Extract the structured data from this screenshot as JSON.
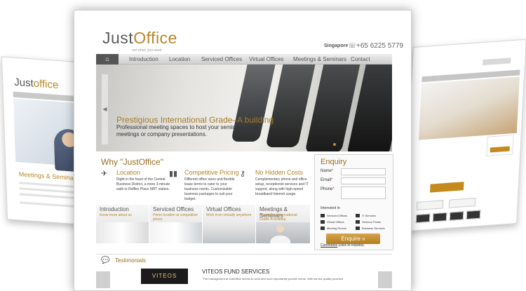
{
  "brand": {
    "logo_just": "Just",
    "logo_office": "Office",
    "tagline": "not when you need",
    "accent": "#b9862b",
    "button_color": "#c58a1d"
  },
  "header": {
    "region": "Singapore",
    "phone_icon": "phone-icon",
    "phone": "+65 6225 5779"
  },
  "nav": {
    "home_icon": "home-icon",
    "items": [
      "Introduction",
      "Location",
      "Serviced Offices",
      "Virtual Offices",
      "Meetings & Seminars",
      "Contact"
    ]
  },
  "hero": {
    "prev_arrow": "◀",
    "title": "Prestigious International Grade–A building",
    "description": "Professional meeting spaces to host your seminars, client meetings or company presentations."
  },
  "why": {
    "title": "Why \"JustOffice\"",
    "features": [
      {
        "icon": "location-icon",
        "title": "Location",
        "desc": "Right in the heart of the Central Business District, a mere 3-minute walk to Raffles Place MRT station."
      },
      {
        "icon": "bar-chart-icon",
        "title": "Competitive Pricing",
        "desc": "Different office sizes and flexible lease terms to cater to your business needs. Customizable business packages to suit your budget."
      },
      {
        "icon": "key-icon",
        "title": "No Hidden Costs",
        "desc": "Complementary phone and office setup, receptionist services and IT support, along with high-speed broadband Internet usage."
      }
    ]
  },
  "tiles": [
    {
      "title": "Introduction",
      "desc": "Know more about us"
    },
    {
      "title": "Serviced Offices",
      "desc": "Prime location at competitive prices"
    },
    {
      "title": "Virtual Offices",
      "desc": "Work from virtually anywhere"
    },
    {
      "title": "Meetings & Seminars",
      "desc": "Prestigious International Grade-A building"
    }
  ],
  "enquiry": {
    "title": "Enquiry",
    "fields": [
      {
        "label": "Name",
        "required": "*",
        "value": ""
      },
      {
        "label": "Email",
        "required": "*",
        "value": ""
      },
      {
        "label": "Phone",
        "required": "*",
        "value": ""
      }
    ],
    "interested_label": "Interested In",
    "options": [
      "Serviced Offices",
      "IT Services",
      "Virtual Offices",
      "Seminar Points",
      "Meeting Rooms",
      "Business Services"
    ],
    "comments_label": "Comments",
    "comments_link": "(click to expand)",
    "button": "Enquire »"
  },
  "testimonials": {
    "icon": "speech-bubble-icon",
    "title": "Testimonials",
    "logo_text": "VITEOS",
    "company": "VITEOS FUND SERVICES",
    "quote": "\"The management at JustOffice seems to work and more importantly provide needs. With service quality provided"
  },
  "left_preview": {
    "logo_just": "Just",
    "logo_office": "office",
    "heading": "Meetings & Seminars"
  }
}
